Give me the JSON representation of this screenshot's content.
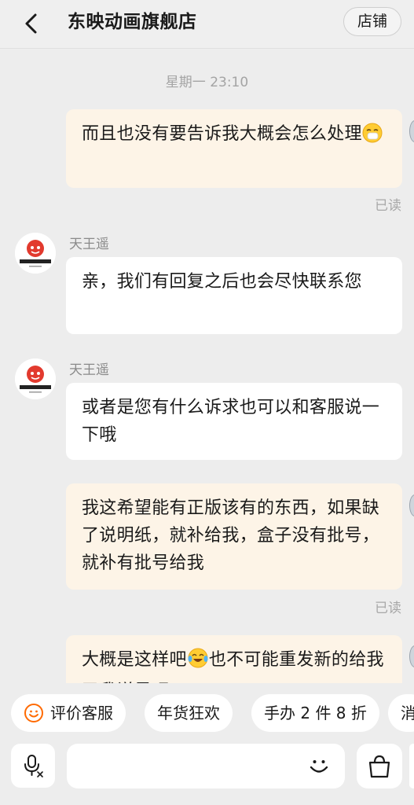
{
  "header": {
    "title": "东映动画旗舰店",
    "store_button": "店铺"
  },
  "chat": {
    "timestamp": "星期一 23:10",
    "messages": [
      {
        "from": "me",
        "text": "而且也没有要告诉我大概会怎么处理",
        "emoji": "sneezing-face",
        "status": "已读"
      },
      {
        "from": "them",
        "sender": "天王遥",
        "avatar_text": "TOEI ANIMATION",
        "text": "亲，我们有回复之后也会尽快联系您"
      },
      {
        "from": "them",
        "sender": "天王遥",
        "avatar_text": "TOEI ANIMATION",
        "text": "或者是您有什么诉求也可以和客服说一下哦"
      },
      {
        "from": "me",
        "text": "我这希望能有正版该有的东西，如果缺了说明纸，就补给我，盒子没有批号，就补有批号给我",
        "status": "已读"
      },
      {
        "from": "me",
        "text_a": "大概是这样吧",
        "emoji": "tears-of-joy-face",
        "text_b": "也不可能重发新的给我了我说是吧"
      }
    ]
  },
  "quick_replies": [
    {
      "label": "评价客服",
      "icon": "smiley-icon"
    },
    {
      "label": "年货狂欢"
    },
    {
      "label": "手办 2 件 8 折"
    },
    {
      "label": "消"
    }
  ],
  "input": {
    "placeholder": "",
    "voice_icon": "microphone-icon",
    "emoji_icon": "smiley-face-icon",
    "cart_icon": "shopping-bag-icon"
  },
  "colors": {
    "background": "#ededed",
    "my_bubble": "#fdf4e7",
    "their_bubble": "#ffffff",
    "accent_orange": "#ff6a00",
    "read_gray": "#a8a8a8"
  }
}
